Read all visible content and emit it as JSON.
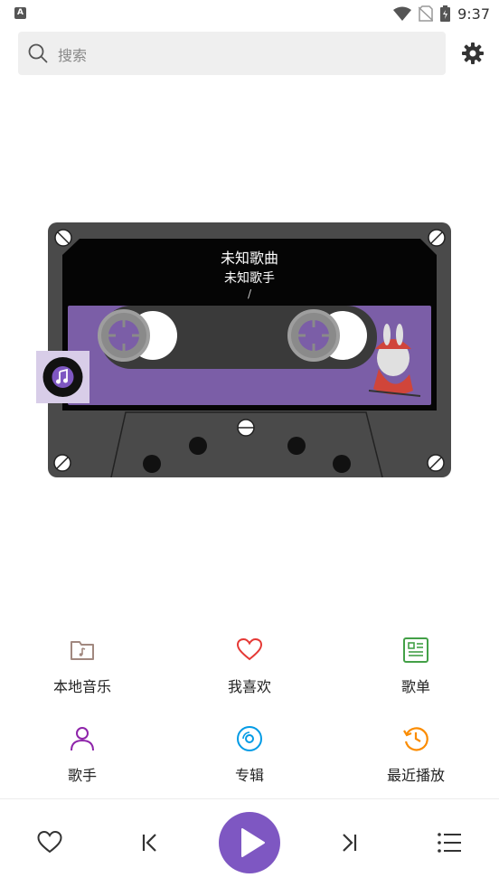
{
  "status_bar": {
    "time": "9:37",
    "left_badge": "A"
  },
  "search": {
    "placeholder": "搜索"
  },
  "now_playing": {
    "title": "未知歌曲",
    "artist": "未知歌手",
    "progress_text": "/"
  },
  "menu": [
    {
      "label": "本地音乐",
      "icon": "folder-music-icon",
      "color": "#a1887f"
    },
    {
      "label": "我喜欢",
      "icon": "heart-icon",
      "color": "#e53935"
    },
    {
      "label": "歌单",
      "icon": "playlist-icon",
      "color": "#43a047"
    },
    {
      "label": "歌手",
      "icon": "person-icon",
      "color": "#8e24aa"
    },
    {
      "label": "专辑",
      "icon": "album-icon",
      "color": "#039be5"
    },
    {
      "label": "最近播放",
      "icon": "history-icon",
      "color": "#fb8c00"
    }
  ],
  "player_bar": {
    "buttons": [
      "heart-icon",
      "previous-icon",
      "play-icon",
      "next-icon",
      "queue-icon"
    ],
    "accent": "#7e57c2"
  }
}
